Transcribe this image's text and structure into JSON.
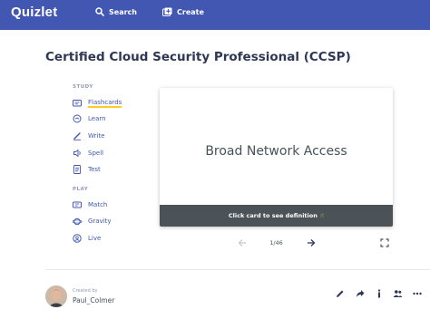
{
  "header": {
    "logo": "Quizlet",
    "search_label": "Search",
    "create_label": "Create",
    "brand_color": "#4257b2"
  },
  "set": {
    "title": "Certified Cloud Security Professional (CCSP)"
  },
  "sidebar": {
    "study_heading": "STUDY",
    "study_items": [
      {
        "label": "Flashcards",
        "icon": "flashcards-icon",
        "active": true
      },
      {
        "label": "Learn",
        "icon": "learn-icon"
      },
      {
        "label": "Write",
        "icon": "write-icon"
      },
      {
        "label": "Spell",
        "icon": "spell-icon"
      },
      {
        "label": "Test",
        "icon": "test-icon"
      }
    ],
    "play_heading": "PLAY",
    "play_items": [
      {
        "label": "Match",
        "icon": "match-icon"
      },
      {
        "label": "Gravity",
        "icon": "gravity-icon"
      },
      {
        "label": "Live",
        "icon": "live-icon"
      }
    ]
  },
  "card": {
    "term": "Broad Network Access",
    "hint": "Click card to see definition",
    "hint_icon": "pointing-hand-icon"
  },
  "controls": {
    "counter": "1/46",
    "prev_icon": "arrow-left-icon",
    "next_icon": "arrow-right-icon",
    "fullscreen_icon": "fullscreen-icon"
  },
  "footer": {
    "created_by": "Created by",
    "author": "Paul_Colmer",
    "actions": [
      "edit-icon",
      "share-icon",
      "info-icon",
      "people-icon",
      "more-icon"
    ]
  }
}
